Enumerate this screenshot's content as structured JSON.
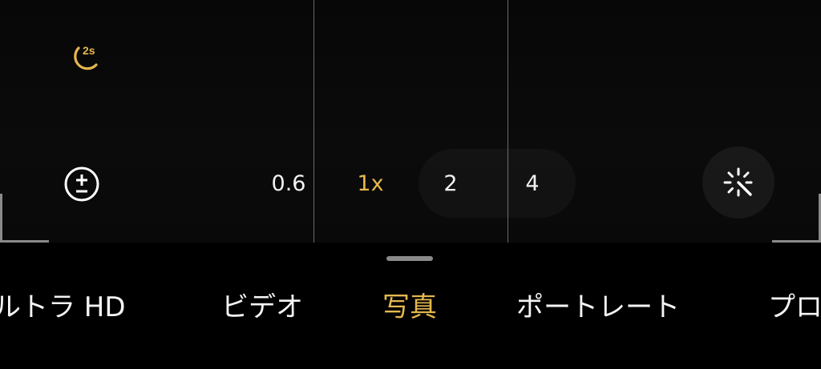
{
  "camera": {
    "night_mode": {
      "timer_label": "2s",
      "accent": "#e5b84f",
      "icon": "moon-icon"
    },
    "exposure": {
      "icon": "exposure-plus-minus-icon"
    },
    "zoom": {
      "levels": [
        "0.6",
        "1x",
        "2",
        "4"
      ],
      "active": "1x"
    },
    "effects": {
      "icon": "magic-wand-icon"
    }
  },
  "modes": {
    "items": [
      "ルトラ HD",
      "ビデオ",
      "写真",
      "ポートレート",
      "プロ"
    ],
    "active": "写真"
  },
  "colors": {
    "accent": "#e5b84f",
    "background": "#000000",
    "text": "#ffffff"
  }
}
